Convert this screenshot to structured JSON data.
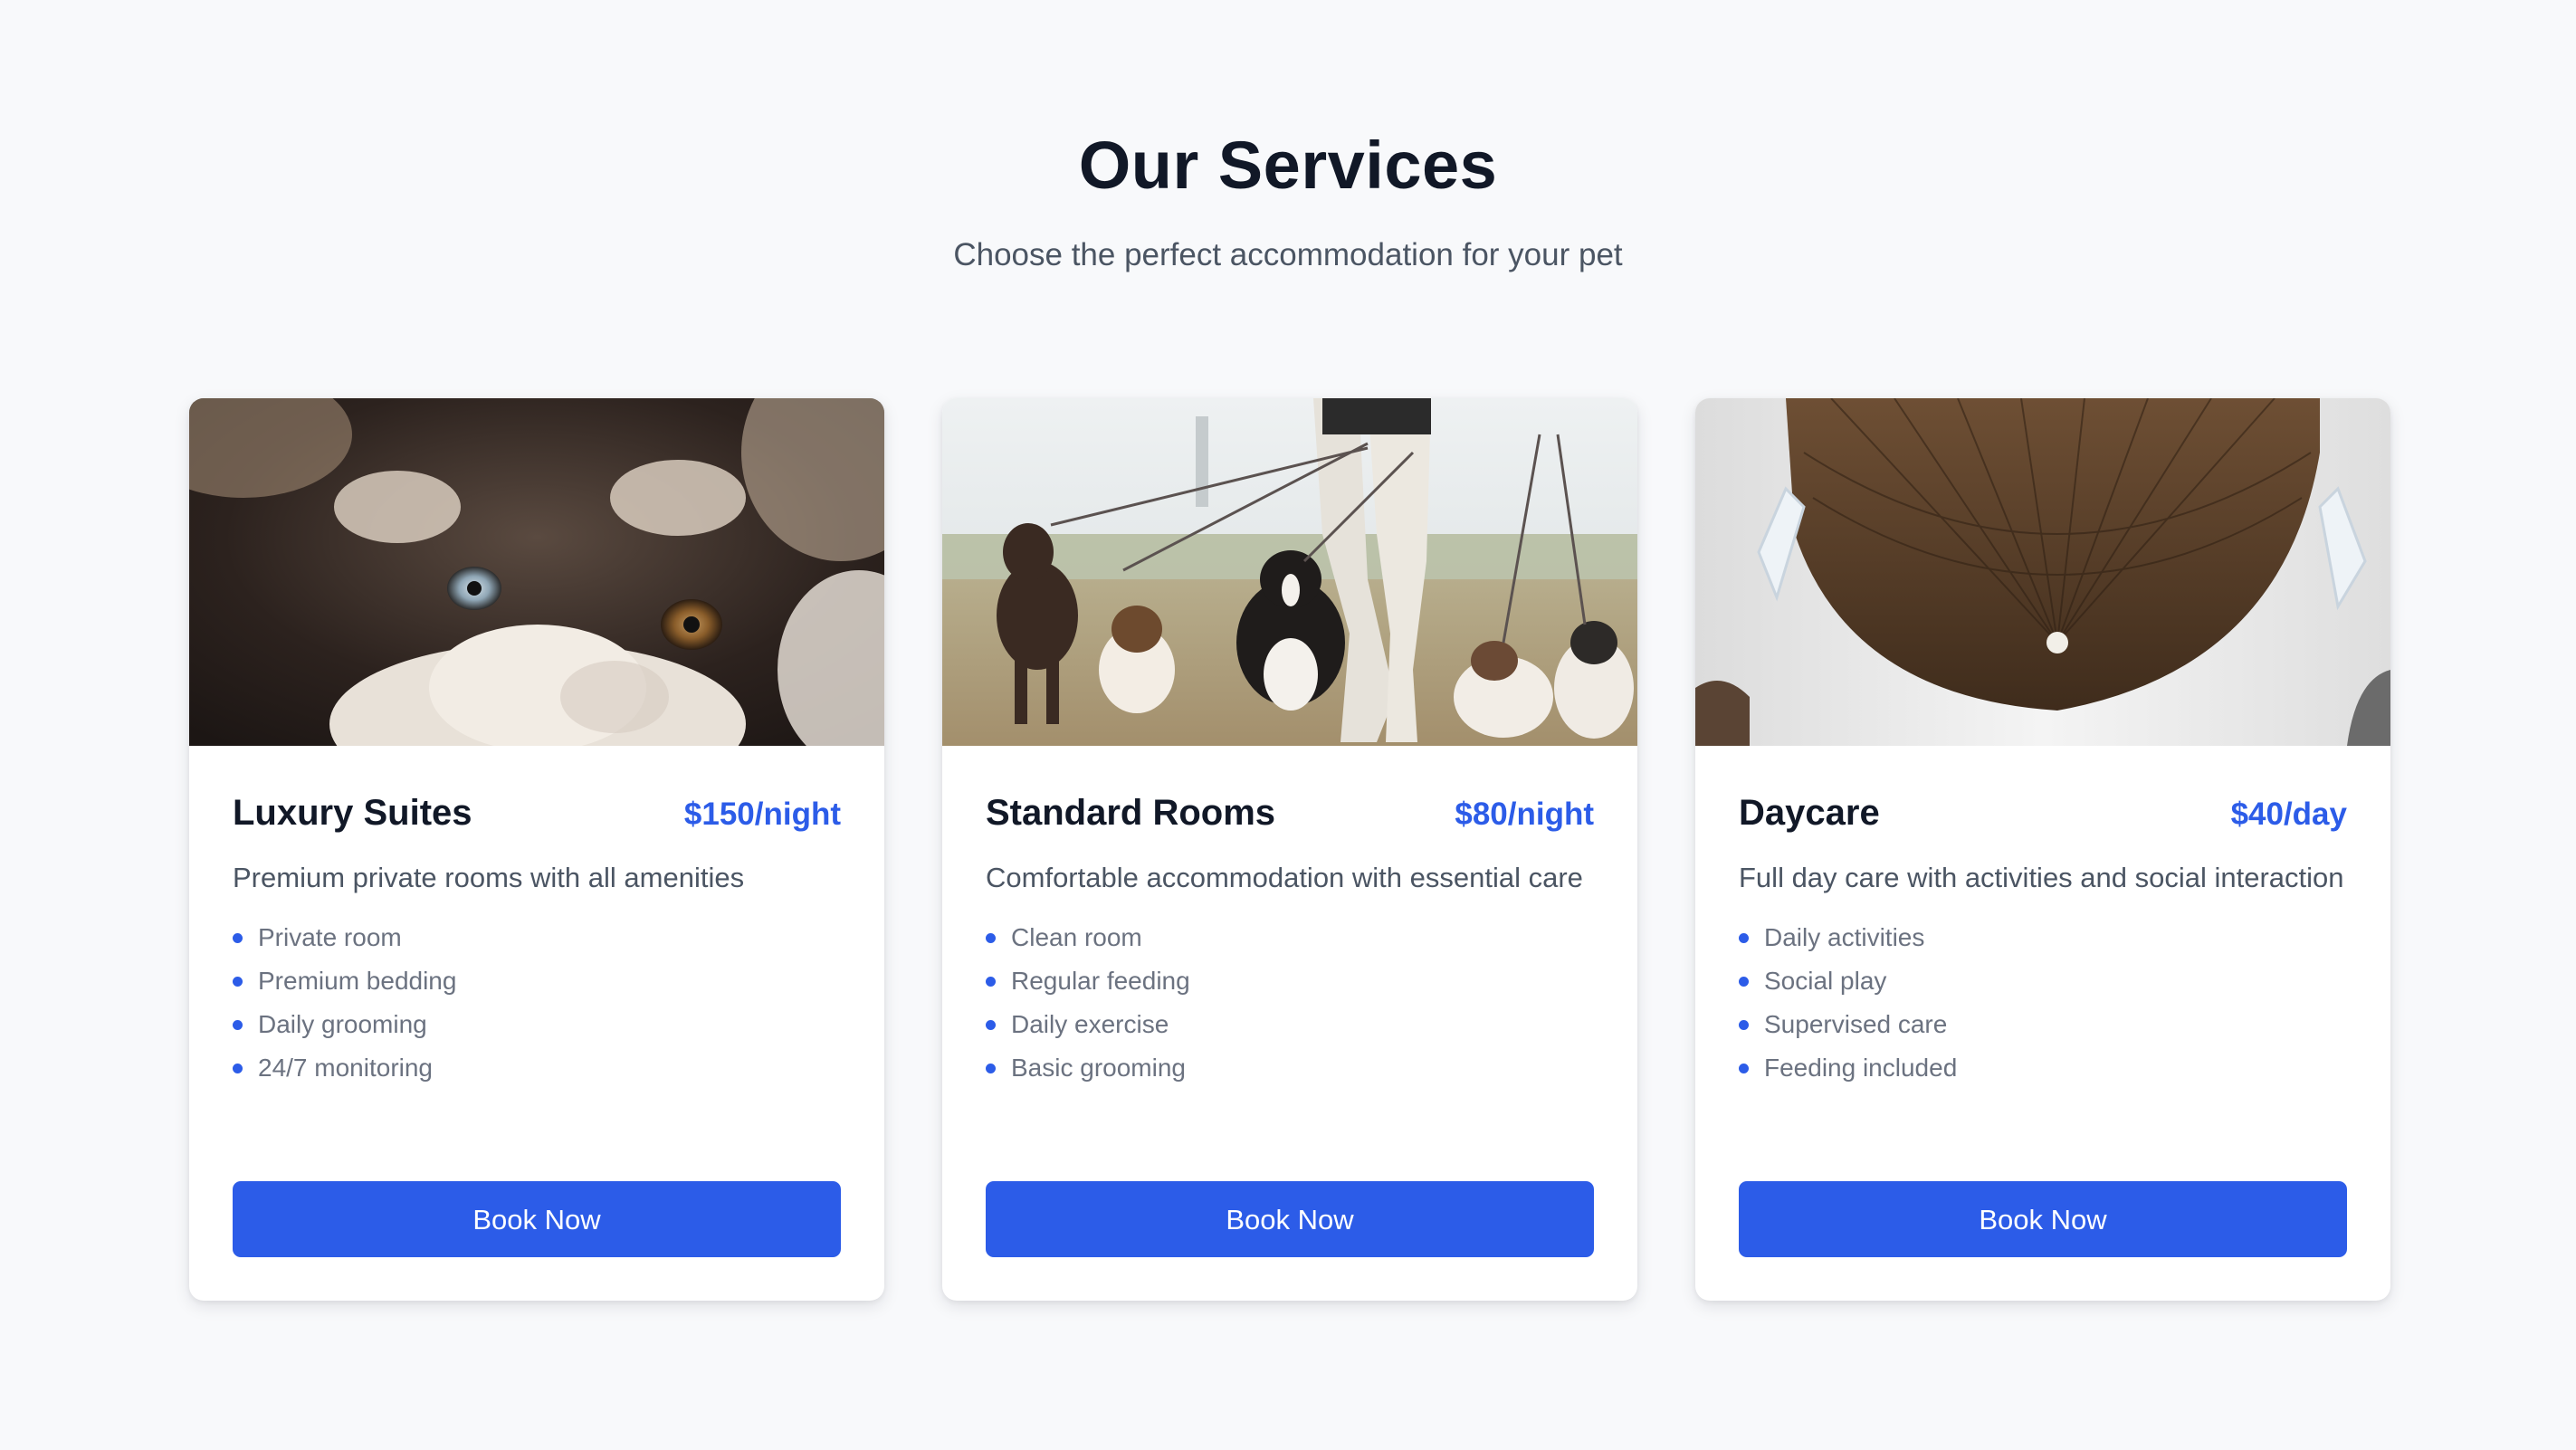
{
  "section": {
    "title": "Our Services",
    "subtitle": "Choose the perfect accommodation for your pet"
  },
  "cards": [
    {
      "image_icon": "husky-puppy-photo",
      "title": "Luxury Suites",
      "price": "$150/night",
      "description": "Premium private rooms with all amenities",
      "features": [
        "Private room",
        "Premium bedding",
        "Daily grooming",
        "24/7 monitoring"
      ],
      "button_label": "Book Now"
    },
    {
      "image_icon": "dog-walker-photo",
      "title": "Standard Rooms",
      "price": "$80/night",
      "description": "Comfortable accommodation with essential care",
      "features": [
        "Clean room",
        "Regular feeding",
        "Daily exercise",
        "Basic grooming"
      ],
      "button_label": "Book Now"
    },
    {
      "image_icon": "wooden-ceiling-photo",
      "title": "Daycare",
      "price": "$40/day",
      "description": "Full day care with activities and social interaction",
      "features": [
        "Daily activities",
        "Social play",
        "Supervised care",
        "Feeding included"
      ],
      "button_label": "Book Now"
    }
  ],
  "colors": {
    "accent": "#2c5ce8",
    "background": "#f8f9fb",
    "heading": "#111827",
    "body_text": "#4b5563",
    "muted_text": "#6b7280"
  }
}
